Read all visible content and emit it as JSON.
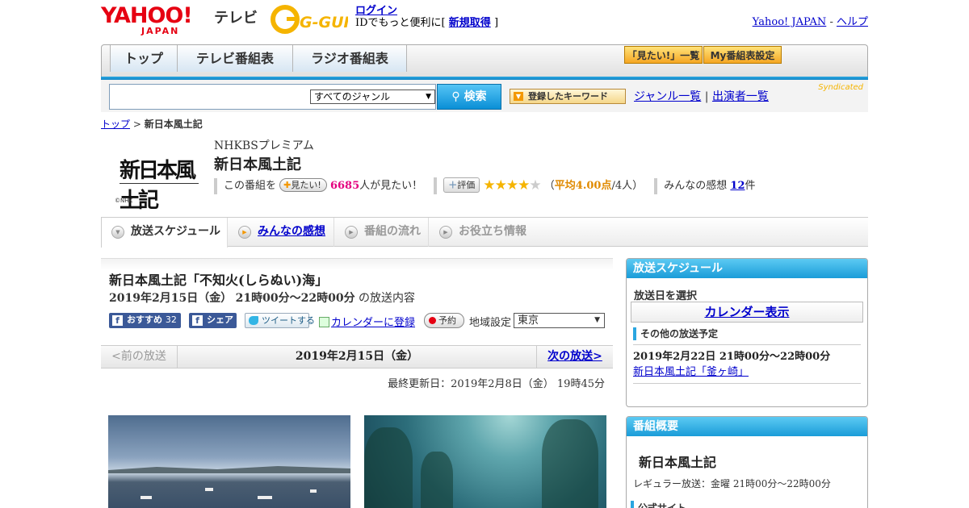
{
  "header": {
    "brand": "YAHOO!",
    "brand_sub": "JAPAN",
    "service": "テレビ",
    "gguide_logo": "G-GUIDE",
    "login_label": "ログイン",
    "login_text": "IDでもっと便利に[",
    "register_label": "新規取得",
    "login_text_end": "]",
    "yahoo_link": "Yahoo! JAPAN",
    "separator": "-",
    "help_link": "ヘルプ"
  },
  "nav": {
    "tabs": [
      {
        "label": "トップ"
      },
      {
        "label": "テレビ番組表"
      },
      {
        "label": "ラジオ番組表"
      }
    ],
    "mitai_list": "「見たい!」一覧",
    "my_bangumi": "My番組表設定"
  },
  "search": {
    "query": "",
    "genre": "すべてのジャンル",
    "button": "検索",
    "keyword_btn": "登録したキーワード",
    "genre_list": "ジャンル一覧",
    "pipe": "|",
    "performer_list": "出演者一覧",
    "syndicated": "Syndicated"
  },
  "breadcrumb": {
    "home": "トップ",
    "sep": ">",
    "current": "新日本風土記"
  },
  "program": {
    "logo_text": "新日本風土記",
    "logo_credit": "©NHK",
    "channel": "NHKBSプレミアム",
    "title": "新日本風土記",
    "mitai_prefix": "この番組を",
    "mitai_btn": "見たい!",
    "mitai_count": "6685",
    "mitai_suffix": "人が見たい！",
    "hyoka_btn": "評価",
    "rating_prefix": "（",
    "rating_avg": "平均4.00点",
    "rating_suffix": "/4人）",
    "rating": 4,
    "kanso_prefix": "みんなの感想",
    "kanso_count": "12",
    "kanso_suffix": "件"
  },
  "tabs": [
    {
      "label": "放送スケジュール"
    },
    {
      "label": "みんなの感想"
    },
    {
      "label": "番組の流れ"
    },
    {
      "label": "お役立ち情報"
    }
  ],
  "episode": {
    "title": "新日本風土記「不知火(しらぬい)海」",
    "date": "2019年2月15日（金）",
    "time": "21時00分～22時00分",
    "date_suffix": "の放送内容",
    "fb_recommend": "おすすめ",
    "fb_count": "32",
    "fb_share": "シェア",
    "tweet": "ツイートする",
    "calendar": "カレンダーに登録",
    "reserve": "予約",
    "area_label": "地域設定",
    "area_value": "東京"
  },
  "pager": {
    "prev": "<前の放送",
    "current": "2019年2月15日（金）",
    "next": "次の放送>"
  },
  "updated": "最終更新日：2019年2月8日（金）  19時45分",
  "schedule": {
    "heading": "放送スケジュール",
    "select_label": "放送日を選択",
    "calendar_btn": "カレンダー表示",
    "other_label": "その他の放送予定",
    "other_date": "2019年2月22日  21時00分～22時00分",
    "other_link": "新日本風土記「釜ヶ崎」"
  },
  "overview": {
    "heading": "番組概要",
    "title": "新日本風土記",
    "regular": "レギュラー放送：金曜 21時00分～22時00分",
    "official": "公式サイト"
  }
}
